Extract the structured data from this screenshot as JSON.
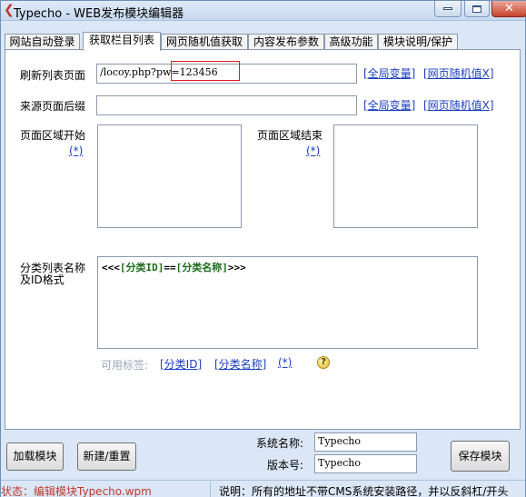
{
  "window": {
    "title": "Typecho - WEB发布模块编辑器"
  },
  "tabs": [
    {
      "label": "网站自动登录"
    },
    {
      "label": "获取栏目列表"
    },
    {
      "label": "网页随机值获取"
    },
    {
      "label": "内容发布参数"
    },
    {
      "label": "高级功能"
    },
    {
      "label": "模块说明/保护"
    }
  ],
  "form": {
    "refresh_label": "刷新列表页面",
    "refresh_value": "/locoy.php?pw=123456",
    "global_var_link": "[全局变量]",
    "random_link": "[网页随机值X]",
    "suffix_label": "来源页面后缀",
    "suffix_value": "",
    "region_start_label": "页面区域开始",
    "region_end_label": "页面区域结束",
    "star_link": "(*)",
    "format_label_line1": "分类列表名称",
    "format_label_line2": "及ID格式",
    "format_value": {
      "prefix": "<<<",
      "id_tag": "[分类ID]",
      "sep": "==",
      "name_tag": "[分类名称]",
      "suffix": ">>>"
    },
    "available_tags_label": "可用标签:",
    "tag_id": "[分类ID]",
    "tag_name": "[分类名称]",
    "tag_star": "(*)"
  },
  "bottom": {
    "load_button": "加载模块",
    "new_button": "新建/重置",
    "system_name_label": "系统名称:",
    "system_name_value": "Typecho",
    "version_label": "版本号:",
    "version_value": "Typecho",
    "save_button": "保存模块"
  },
  "status": {
    "left": "状态：编辑模块Typecho.wpm",
    "right": "说明：所有的地址不带CMS系统安装路径，并以反斜杠/开头"
  },
  "colors": {
    "accent_red": "#c0392b",
    "link_blue": "#1c3fbf",
    "code_green": "#1b6b1b"
  }
}
